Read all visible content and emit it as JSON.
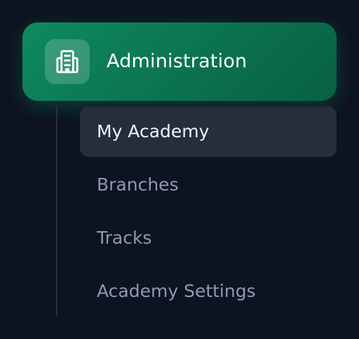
{
  "section": {
    "icon": "building-icon",
    "label": "Administration",
    "accent_color": "#0b7a54"
  },
  "submenu": {
    "items": [
      {
        "label": "My Academy",
        "active": true
      },
      {
        "label": "Branches",
        "active": false
      },
      {
        "label": "Tracks",
        "active": false
      },
      {
        "label": "Academy Settings",
        "active": false
      }
    ]
  }
}
